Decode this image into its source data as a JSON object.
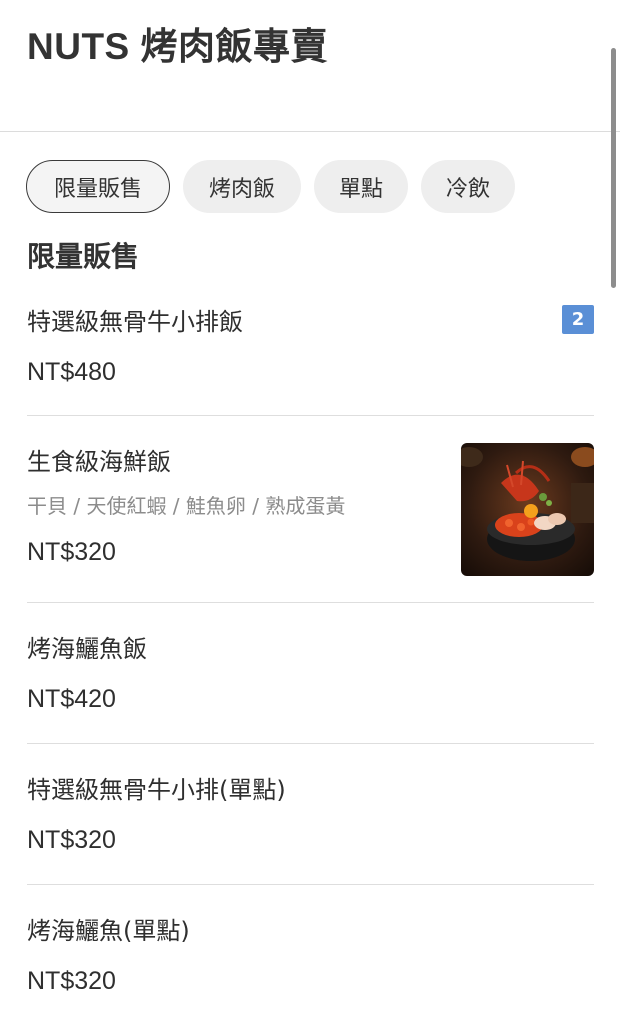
{
  "header": {
    "title": "NUTS 烤肉飯專賣"
  },
  "tabs": [
    {
      "label": "限量販售",
      "active": true
    },
    {
      "label": "烤肉飯",
      "active": false
    },
    {
      "label": "單點",
      "active": false
    },
    {
      "label": "冷飲",
      "active": false
    }
  ],
  "section": {
    "title": "限量販售"
  },
  "items": [
    {
      "name": "特選級無骨牛小排飯",
      "price": "NT$480",
      "badge": "2"
    },
    {
      "name": "生食級海鮮飯",
      "desc": "干貝 / 天使紅蝦 / 鮭魚卵 / 熟成蛋黃",
      "price": "NT$320",
      "image": "seafood-rice-bowl"
    },
    {
      "name": "烤海鱺魚飯",
      "price": "NT$420"
    },
    {
      "name": "特選級無骨牛小排(單點)",
      "price": "NT$320"
    },
    {
      "name": "烤海鱺魚(單點)",
      "price": "NT$320"
    }
  ],
  "colors": {
    "badge": "#5a8fd6",
    "tab_bg": "#eeeeee",
    "divider": "#dedede"
  }
}
